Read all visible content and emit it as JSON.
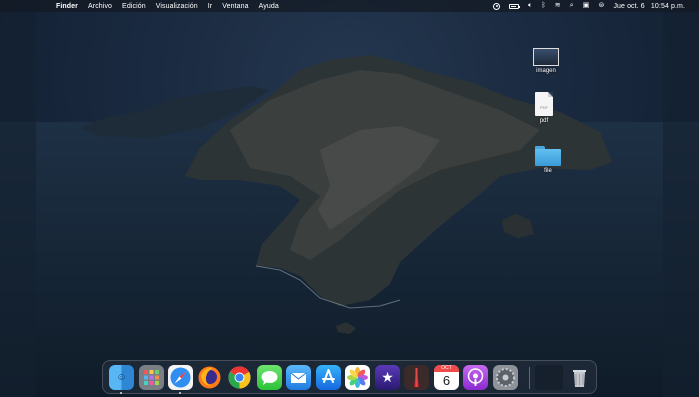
{
  "menubar": {
    "apple_glyph": "",
    "app_name": "Finder",
    "menus": [
      "Archivo",
      "Edición",
      "Visualización",
      "Ir",
      "Ventana",
      "Ayuda"
    ],
    "datetime": "Jue oct. 6   10:54 p.m.",
    "battery_level": 0.8
  },
  "desktop_icons": [
    {
      "label": "imagen",
      "kind": "image-thumbnail"
    },
    {
      "label": "pdf",
      "kind": "pdf-document",
      "doc_tag": "PDF"
    },
    {
      "label": "file",
      "kind": "folder"
    }
  ],
  "dock": {
    "apps": [
      {
        "name": "Finder",
        "icon": "finder-icon",
        "running": true
      },
      {
        "name": "Launchpad",
        "icon": "launchpad-icon",
        "running": false
      },
      {
        "name": "Safari",
        "icon": "safari-icon",
        "running": true
      },
      {
        "name": "Firefox",
        "icon": "firefox-icon",
        "running": false
      },
      {
        "name": "Chrome",
        "icon": "chrome-icon",
        "running": false
      },
      {
        "name": "Messages",
        "icon": "messages-icon",
        "running": false
      },
      {
        "name": "Mail",
        "icon": "mail-icon",
        "running": false
      },
      {
        "name": "App Store",
        "icon": "app-store-icon",
        "running": false
      },
      {
        "name": "Photos",
        "icon": "photos-icon",
        "running": false
      },
      {
        "name": "iMovie",
        "icon": "imovie-icon",
        "running": false
      },
      {
        "name": "Photo Booth",
        "icon": "photo-booth-icon",
        "running": false
      },
      {
        "name": "Calendar",
        "icon": "calendar-icon",
        "running": false,
        "month": "OCT",
        "day": "6"
      },
      {
        "name": "Podcasts",
        "icon": "podcasts-icon",
        "running": false
      },
      {
        "name": "System Preferences",
        "icon": "system-preferences-icon",
        "running": false
      }
    ],
    "trash": {
      "name": "Trash",
      "icon": "trash-icon"
    }
  }
}
